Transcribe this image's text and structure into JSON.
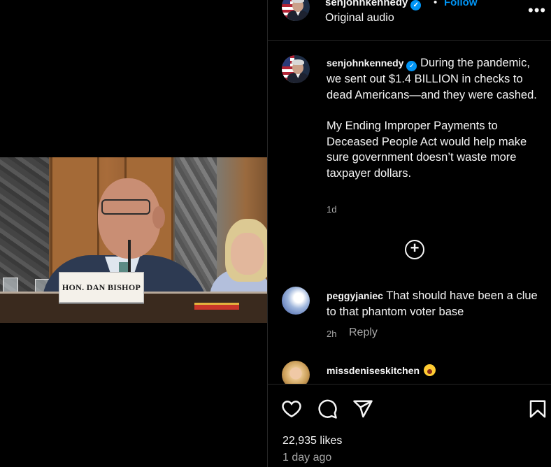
{
  "video": {
    "nameplate": "HON. DAN BISHOP"
  },
  "header": {
    "username": "senjohnkennedy",
    "separator": "•",
    "follow_label": "Follow",
    "audio_label": "Original audio",
    "more_label": "•••"
  },
  "caption": {
    "username": "senjohnkennedy",
    "paragraph1": "During the pandemic, we sent out $1.4 BILLION in checks to dead Americans—and they were cashed.",
    "paragraph2": "My Ending Improper Payments to Deceased People Act would help make sure government doesn’t waste more taxpayer dollars.",
    "age": "1d"
  },
  "load_more": "+",
  "comments": [
    {
      "username": "peggyjaniec",
      "text": "That should have been a clue to that phantom voter base",
      "age": "2h",
      "reply_label": "Reply"
    },
    {
      "username": "missdeniseskitchen",
      "text": ""
    }
  ],
  "footer": {
    "likes": "22,935 likes",
    "posted": "1 day ago"
  },
  "icons": [
    "heart-icon",
    "comment-icon",
    "share-icon",
    "bookmark-icon",
    "verified-badge-icon",
    "add-circle-icon",
    "more-icon"
  ],
  "colors": {
    "accent": "#0095f6",
    "background": "#000000",
    "muted": "#a8a8a8"
  }
}
